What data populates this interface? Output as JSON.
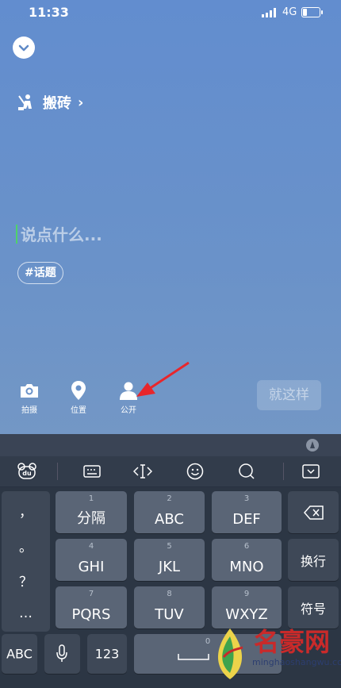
{
  "status_bar": {
    "time": "11:33",
    "network": "4G",
    "battery_level": 0.3
  },
  "header": {
    "circle_label": "搬砖",
    "circle_chevron": "›"
  },
  "composer": {
    "placeholder": "说点什么...",
    "topic_label": "#话题"
  },
  "toolbar": {
    "photo_label": "拍摄",
    "location_label": "位置",
    "visibility_label": "公开",
    "submit_label": "就这样"
  },
  "keyboard": {
    "bar_icons": [
      "du-logo-icon",
      "keyboard-icon",
      "cursor-move-icon",
      "emoji-icon",
      "search-icon",
      "collapse-keyboard-icon"
    ],
    "punctuation": [
      "，",
      "。",
      "？",
      "…"
    ],
    "rows": [
      [
        {
          "num": "1",
          "label": "分隔"
        },
        {
          "num": "2",
          "label": "ABC"
        },
        {
          "num": "3",
          "label": "DEF"
        }
      ],
      [
        {
          "num": "4",
          "label": "GHI"
        },
        {
          "num": "5",
          "label": "JKL"
        },
        {
          "num": "6",
          "label": "MNO"
        }
      ],
      [
        {
          "num": "7",
          "label": "PQRS"
        },
        {
          "num": "8",
          "label": "TUV"
        },
        {
          "num": "9",
          "label": "WXYZ"
        }
      ]
    ],
    "newline_label": "换行",
    "symbols_label": "符号",
    "abc_label": "ABC",
    "num_label": "123",
    "space_num": "0"
  },
  "watermark": {
    "title": "名豪网",
    "subtitle": "minghaoshangwu.com"
  },
  "colors": {
    "accent_caret": "#4fd26a",
    "annotation_arrow": "#e8262b"
  }
}
